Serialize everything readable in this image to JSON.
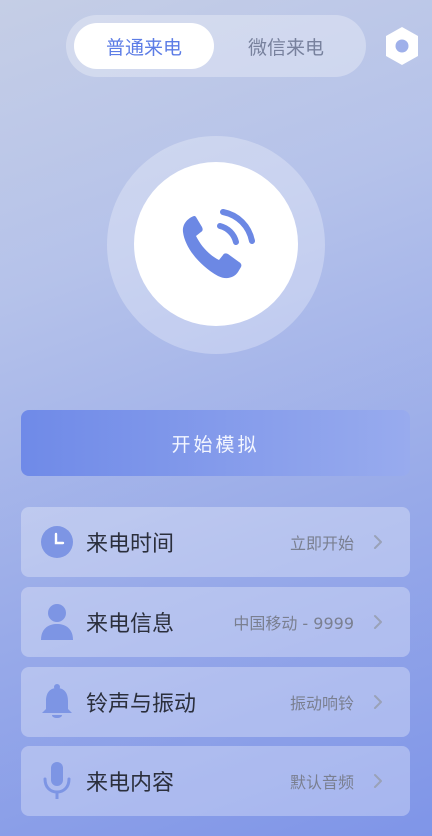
{
  "tabs": [
    {
      "label": "普通来电",
      "active": true
    },
    {
      "label": "微信来电",
      "active": false
    }
  ],
  "icons": {
    "settings": "settings-hex-icon",
    "phone": "phone-call-icon",
    "clock": "clock-icon",
    "person": "person-icon",
    "bell": "bell-icon",
    "mic": "microphone-icon",
    "chevron": "chevron-right-icon"
  },
  "start_button": {
    "label": "开始模拟"
  },
  "rows": [
    {
      "label": "来电时间",
      "value": "立即开始"
    },
    {
      "label": "来电信息",
      "value": "中国移动 - 9999"
    },
    {
      "label": "铃声与振动",
      "value": "振动响铃"
    },
    {
      "label": "来电内容",
      "value": "默认音频"
    }
  ],
  "colors": {
    "accent": "#5d7de6",
    "icon": "#7d95e4",
    "background_top": "#c5cee6",
    "background_bottom": "#7f95e8"
  }
}
